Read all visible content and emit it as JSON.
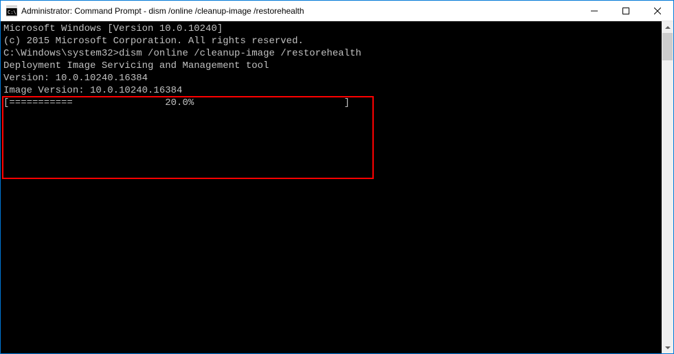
{
  "window": {
    "title": "Administrator: Command Prompt - dism  /online /cleanup-image /restorehealth"
  },
  "terminal": {
    "line_version": "Microsoft Windows [Version 10.0.10240]",
    "line_copyright": "(c) 2015 Microsoft Corporation. All rights reserved.",
    "blank": "",
    "prompt": "C:\\Windows\\system32>",
    "command": "dism /online /cleanup-image /restorehealth",
    "dism_header": "Deployment Image Servicing and Management tool",
    "dism_version": "Version: 10.0.10240.16384",
    "image_version": "Image Version: 10.0.10240.16384",
    "progress_line": "[===========                20.0%                          ]"
  }
}
